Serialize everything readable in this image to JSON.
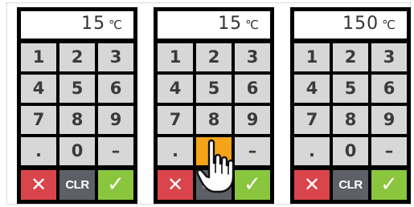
{
  "panels": [
    {
      "display": {
        "value": "15",
        "unit": "℃"
      },
      "pressed_key": null
    },
    {
      "display": {
        "value": "15",
        "unit": "℃"
      },
      "pressed_key": "8"
    },
    {
      "display": {
        "value": "150",
        "unit": "℃"
      },
      "pressed_key": null
    }
  ],
  "keypad": {
    "keys": [
      "1",
      "2",
      "3",
      "4",
      "5",
      "6",
      "7",
      "8",
      "9",
      ".",
      "0",
      "–"
    ],
    "cancel_symbol": "✕",
    "clear_label": "CLR",
    "confirm_symbol": "✓"
  },
  "colors": {
    "panel_bg": "#000000",
    "key_bg": "#d7d7d7",
    "key_pressed": "#f5a41a",
    "cancel": "#d9454b",
    "clear": "#5d6066",
    "confirm": "#8ac53e"
  },
  "icons": {
    "pointer": "hand-pointer-icon"
  }
}
